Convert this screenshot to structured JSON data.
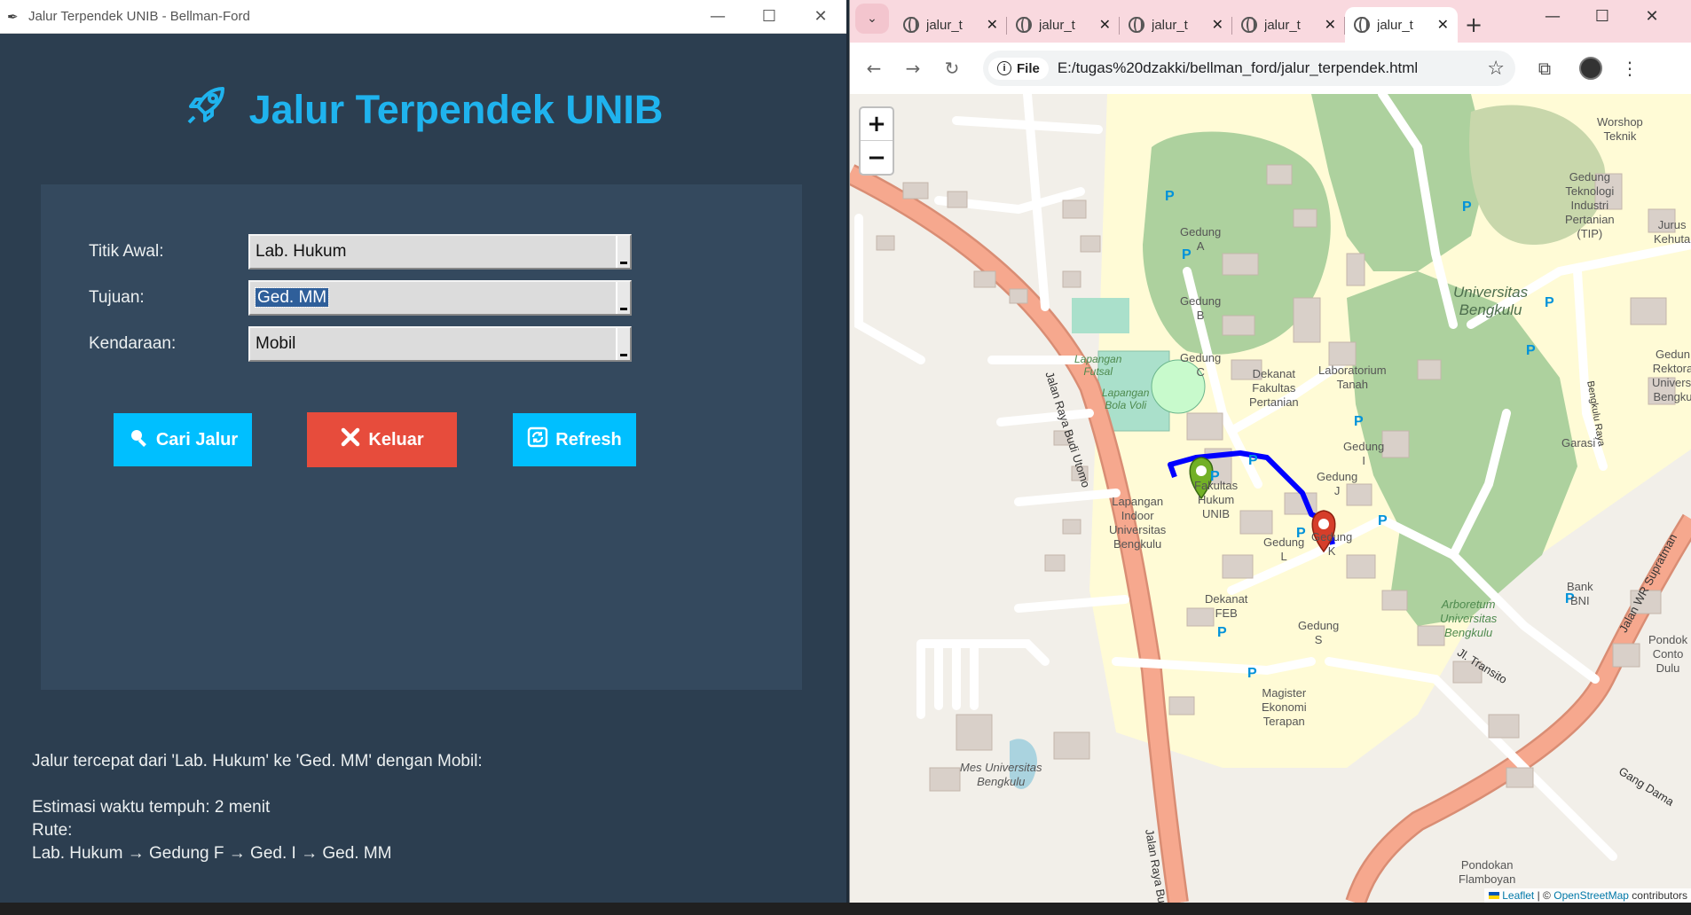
{
  "app": {
    "window_title": "Jalur Terpendek UNIB - Bellman-Ford",
    "heading": "Jalur Terpendek UNIB",
    "form": {
      "start_label": "Titik Awal:",
      "start_value": "Lab. Hukum",
      "dest_label": "Tujuan:",
      "dest_value": "Ged. MM",
      "vehicle_label": "Kendaraan:",
      "vehicle_value": "Mobil"
    },
    "buttons": {
      "search": "Cari Jalur",
      "exit": "Keluar",
      "refresh": "Refresh"
    },
    "colors": {
      "search": "#00bfff",
      "exit": "#e74c3c",
      "refresh": "#00bfff",
      "heading": "#1fb3ee"
    },
    "result": {
      "line1": "Jalur tercepat dari 'Lab. Hukum' ke 'Ged. MM' dengan Mobil:",
      "line2": "Estimasi waktu tempuh: 2 menit",
      "line3": "Rute:",
      "line4": "Lab. Hukum → Gedung F → Ged. I → Ged. MM"
    }
  },
  "browser": {
    "tabs": [
      {
        "label": "jalur_t",
        "active": false
      },
      {
        "label": "jalur_t",
        "active": false
      },
      {
        "label": "jalur_t",
        "active": false
      },
      {
        "label": "jalur_t",
        "active": false
      },
      {
        "label": "jalur_t",
        "active": true
      }
    ],
    "scheme_chip": "File",
    "url": "E:/tugas%20dzakki/bellman_ford/jalur_terpendek.html",
    "map": {
      "zoom_in": "+",
      "zoom_out": "−",
      "attribution_leaflet": "Leaflet",
      "attribution_osm": "OpenStreetMap",
      "attribution_tail": "contributors",
      "attribution_sep": " | © ",
      "route_color": "#0000ff",
      "start_marker_color": "#72b026",
      "end_marker_color": "#d63e2a",
      "labels": {
        "road_budi_utomo": "Jalan Raya Budi Utomo",
        "road_budi_utomo_2": "Jalan Raya Budi U",
        "road_wr_supratman": "Jalan WR Supratman",
        "road_transito": "Jl. Transito",
        "road_gang_damai": "Gang Dama",
        "road_bengkulu_raya": "Bengkulu Raya",
        "univ": "Universitas\nBengkulu",
        "arboretum": "Arboretum\nUniversitas\nBengkulu",
        "mes": "Mes Universitas\nBengkulu",
        "lapangan_futsal": "Lapangan\nFutsal",
        "lapangan_voli": "Lapangan\nBola Voli",
        "lapangan_indoor": "Lapangan\nIndoor\nUniversitas\nBengkulu",
        "gedung_a": "Gedung\nA",
        "gedung_b": "Gedung\nB",
        "gedung_c": "Gedung\nC",
        "gedung_i": "Gedung\nI",
        "gedung_j": "Gedung\nJ",
        "gedung_k": "Gedung\nK",
        "gedung_l": "Gedung\nL",
        "gedung_s": "Gedung\nS",
        "fak_hukum": "Fakultas\nHukum\nUNIB",
        "dekanat_pertanian": "Dekanat\nFakultas\nPertanian",
        "lab_tanah": "Laboratorium\nTanah",
        "dekanat_feb": "Dekanat\nFEB",
        "magister": "Magister\nEkonomi\nTerapan",
        "workshop": "Worshop\nTeknik",
        "gedung_tip": "Gedung\nTeknologi\nIndustri\nPertanian\n(TIP)",
        "jurusan": "Jurus\nKehuta",
        "rektorat": "Gedun\nRektora\nUniversi\nBengku",
        "garasi": "Garasi",
        "bank_bni": "Bank\nBNI",
        "pondok_conto": "Pondok\nConto\nDulu",
        "pondokan": "Pondokan\nFlamboyan"
      }
    }
  }
}
